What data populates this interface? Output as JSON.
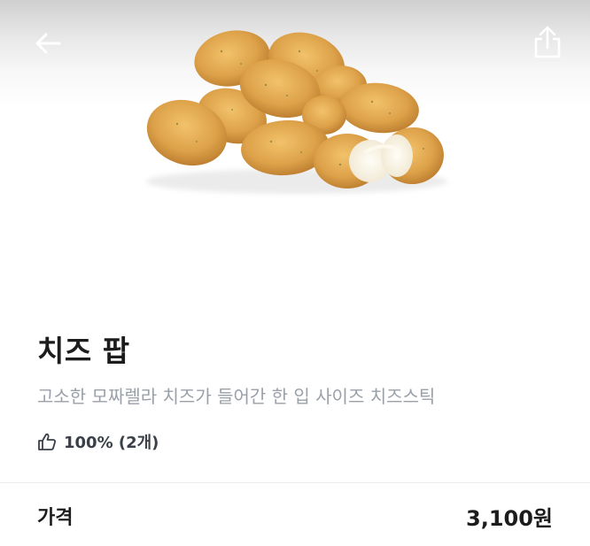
{
  "header": {
    "back_icon": "arrow-left-icon",
    "share_icon": "share-icon"
  },
  "product": {
    "image": "cheese-pop-photo",
    "name": "치즈 팝",
    "description": "고소한 모짜렐라 치즈가 들어간 한 입 사이즈 치즈스틱",
    "rating_icon": "thumbs-up-icon",
    "rating_text": "100% (2개)"
  },
  "price": {
    "label": "가격",
    "value": "3,100원"
  }
}
